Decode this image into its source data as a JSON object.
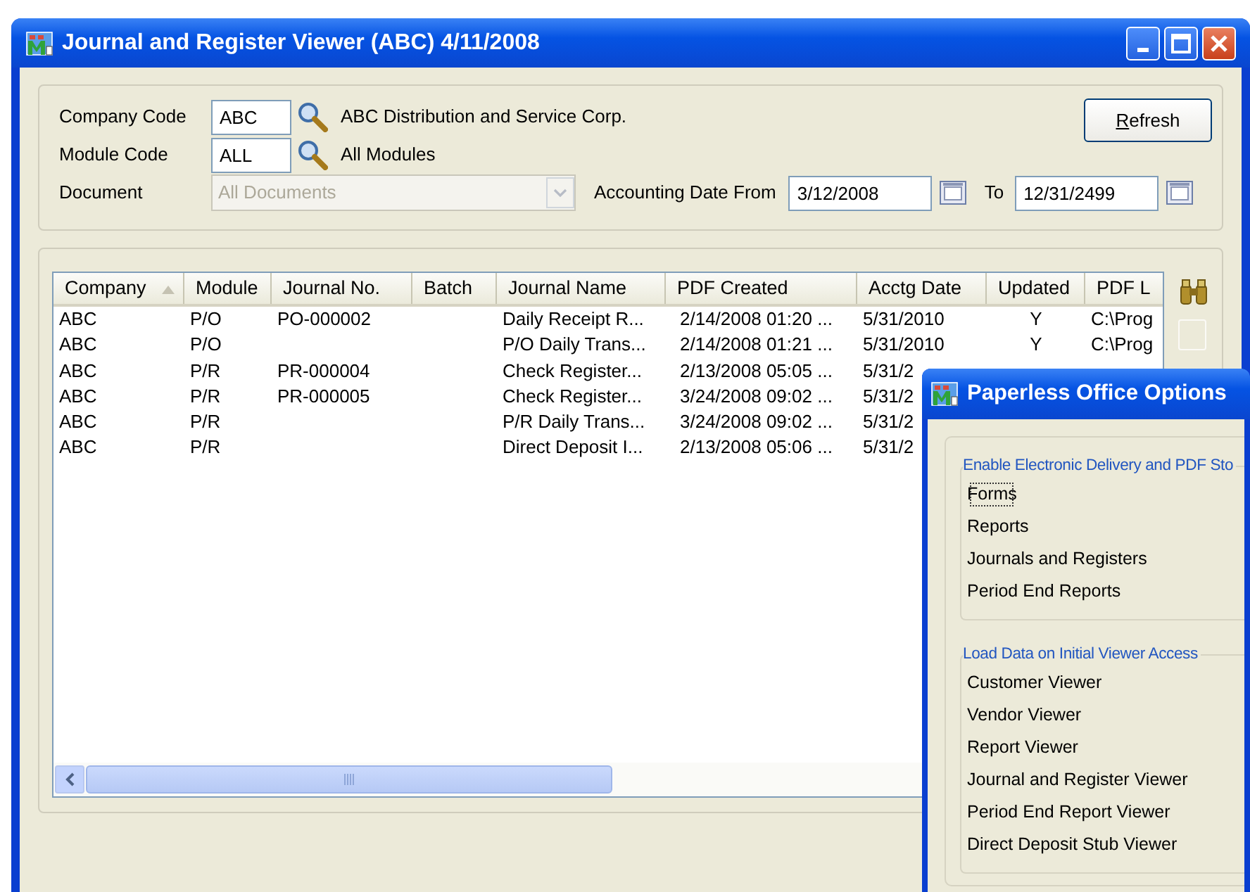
{
  "main_window": {
    "title": "Journal and Register Viewer (ABC) 4/11/2008",
    "filters": {
      "company_code": {
        "label": "Company Code",
        "value": "ABC",
        "description": "ABC Distribution and Service Corp."
      },
      "module_code": {
        "label": "Module Code",
        "value": "ALL",
        "description": "All Modules"
      },
      "document": {
        "label": "Document",
        "value": "All Documents",
        "disabled": true
      },
      "date_from": {
        "label": "Accounting Date From",
        "value": "3/12/2008"
      },
      "date_to": {
        "label": "To",
        "value": "12/31/2499"
      }
    },
    "refresh_button": {
      "label": "Refresh",
      "accelerator": true
    },
    "table": {
      "columns": [
        {
          "label": "Company",
          "sorted": true
        },
        {
          "label": "Module",
          "sorted": false
        },
        {
          "label": "Journal No.",
          "sorted": false
        },
        {
          "label": "Batch",
          "sorted": false
        },
        {
          "label": "Journal Name",
          "sorted": false
        },
        {
          "label": "PDF Created",
          "sorted": false
        },
        {
          "label": "Acctg Date",
          "sorted": false
        },
        {
          "label": "Updated",
          "sorted": false
        },
        {
          "label": "PDF L",
          "sorted": false
        }
      ],
      "rows": [
        {
          "company": "ABC",
          "module": "P/O",
          "journal_no": "PO-000002",
          "journal_name": "Daily Receipt R...",
          "pdf_created": "2/14/2008 01:20 ...",
          "acctg_date": "5/31/2010",
          "updated": "Y",
          "column_9": "C:\\Prog"
        },
        {
          "company": "ABC",
          "module": "P/O",
          "journal_name": "P/O Daily Trans...",
          "pdf_created": "2/14/2008 01:21 ...",
          "acctg_date": "5/31/2010",
          "updated": "Y",
          "column_9": "C:\\Prog"
        },
        {
          "company": "ABC",
          "module": "P/R",
          "journal_no": "PR-000004",
          "journal_name": "Check Register...",
          "pdf_created": "2/13/2008 05:05 ...",
          "acctg_date": "5/31/2"
        },
        {
          "company": "ABC",
          "module": "P/R",
          "journal_no": "PR-000005",
          "journal_name": "Check Register...",
          "pdf_created": "3/24/2008 09:02 ...",
          "acctg_date": "5/31/2"
        },
        {
          "company": "ABC",
          "module": "P/R",
          "journal_name": "P/R Daily Trans...",
          "pdf_created": "3/24/2008 09:02 ...",
          "acctg_date": "5/31/2"
        },
        {
          "company": "ABC",
          "module": "P/R",
          "journal_name": "Direct Deposit I...",
          "pdf_created": "2/13/2008 05:06 ...",
          "acctg_date": "5/31/2"
        }
      ]
    }
  },
  "dialog": {
    "title": "Paperless Office Options",
    "groups": [
      {
        "title": "Enable Electronic Delivery and PDF Sto",
        "items": [
          {
            "label": "Forms",
            "focused": true
          },
          {
            "label": "Reports",
            "focused": false
          },
          {
            "label": "Journals and Registers",
            "focused": false
          },
          {
            "label": "Period End Reports",
            "focused": false
          }
        ]
      },
      {
        "title": "Load Data on Initial Viewer Access",
        "items": [
          {
            "label": "Customer Viewer",
            "focused": false
          },
          {
            "label": "Vendor Viewer",
            "focused": false
          },
          {
            "label": "Report Viewer",
            "focused": false
          },
          {
            "label": "Journal and Register Viewer",
            "focused": false
          },
          {
            "label": "Period End Report Viewer",
            "focused": false
          },
          {
            "label": "Direct Deposit Stub Viewer",
            "focused": false
          }
        ]
      }
    ]
  }
}
